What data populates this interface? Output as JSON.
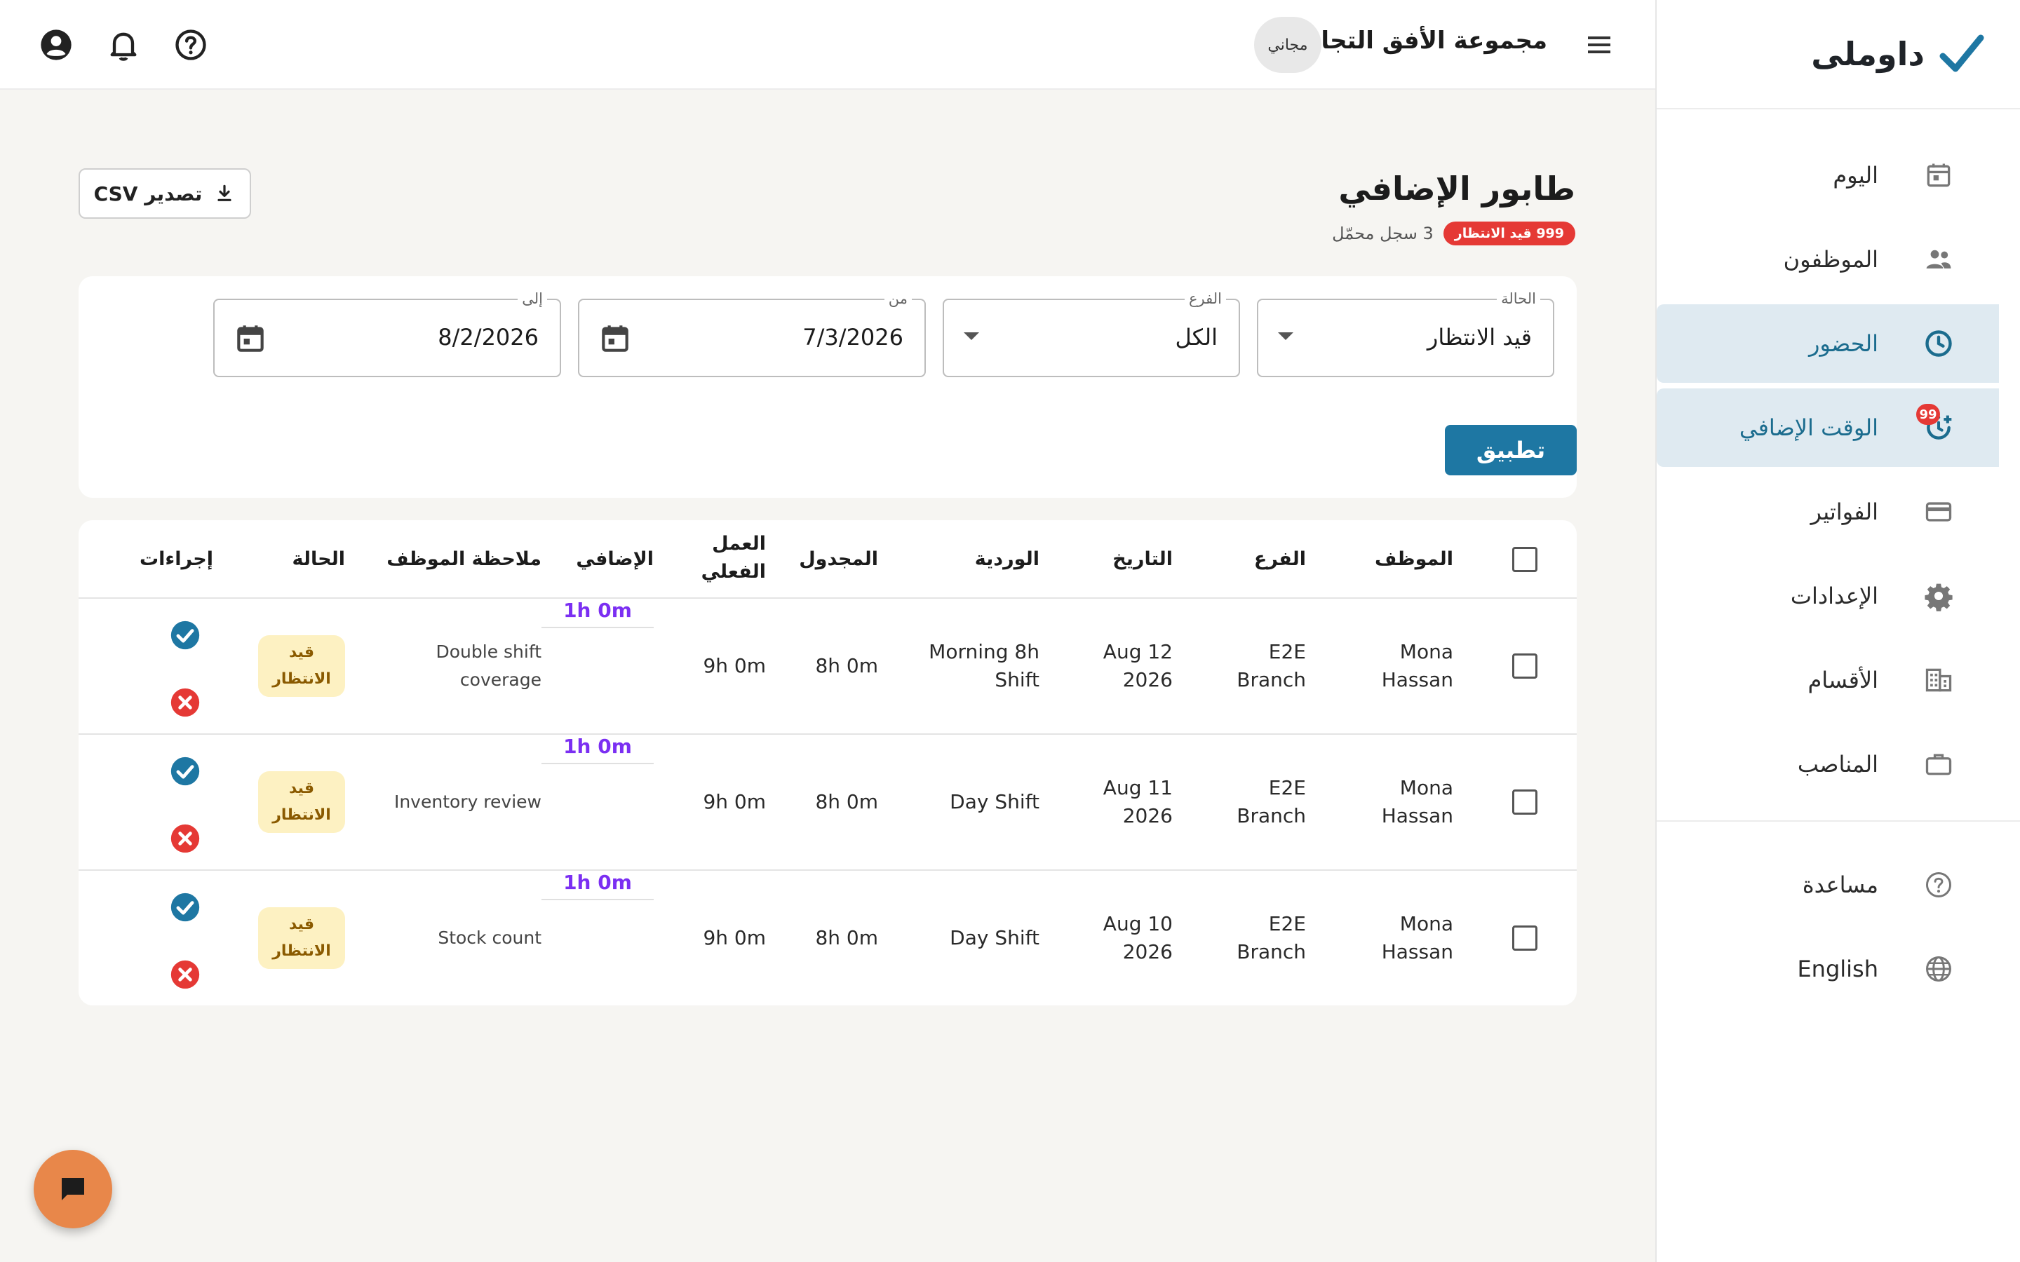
{
  "brand": {
    "name": "داوملى"
  },
  "topbar": {
    "org_name": "مجموعة الأفق التجارية",
    "plan": "مجاني"
  },
  "sidebar": {
    "items": [
      {
        "label": "اليوم",
        "icon": "calendar-icon"
      },
      {
        "label": "الموظفون",
        "icon": "people-icon"
      },
      {
        "label": "الحضور",
        "icon": "clock-icon",
        "active": true
      },
      {
        "label": "الوقت الإضافي",
        "icon": "overtime-clock-icon",
        "badge": "99"
      },
      {
        "label": "الفواتير",
        "icon": "credit-card-icon"
      },
      {
        "label": "الإعدادات",
        "icon": "gear-icon"
      },
      {
        "label": "الأقسام",
        "icon": "building-icon"
      },
      {
        "label": "المناصب",
        "icon": "briefcase-icon"
      }
    ],
    "footer": [
      {
        "label": "مساعدة",
        "icon": "help-icon"
      },
      {
        "label": "English",
        "icon": "globe-icon"
      }
    ]
  },
  "page": {
    "title": "طابور الإضافي",
    "record_count": "3 سجل محمّل",
    "pending_badge": "999 قيد الانتظار",
    "export_label": "تصدير CSV"
  },
  "filters": {
    "status": {
      "label": "الحالة",
      "value": "قيد الانتظار"
    },
    "branch": {
      "label": "الفرع",
      "value": "الكل"
    },
    "from": {
      "label": "من",
      "value": "7/3/2026"
    },
    "to": {
      "label": "إلى",
      "value": "8/2/2026"
    },
    "apply_label": "تطبيق"
  },
  "table": {
    "headers": {
      "employee": "الموظف",
      "branch": "الفرع",
      "date": "التاريخ",
      "shift": "الوردية",
      "scheduled": "المجدول",
      "actual_1": "العمل",
      "actual_2": "الفعلي",
      "overtime": "الإضافي",
      "note": "ملاحظة الموظف",
      "status": "الحالة",
      "actions": "إجراءات"
    },
    "rows": [
      {
        "employee_1": "Mona",
        "employee_2": "Hassan",
        "branch_1": "E2E",
        "branch_2": "Branch",
        "date_1": "Aug 12",
        "date_2": "2026",
        "shift_1": "Morning 8h",
        "shift_2": "Shift",
        "scheduled": "8h 0m",
        "actual": "9h 0m",
        "overtime": "1h 0m",
        "note_1": "Double shift",
        "note_2": "coverage",
        "status_1": "قيد",
        "status_2": "الانتظار"
      },
      {
        "employee_1": "Mona",
        "employee_2": "Hassan",
        "branch_1": "E2E",
        "branch_2": "Branch",
        "date_1": "Aug 11",
        "date_2": "2026",
        "shift_1": "Day Shift",
        "shift_2": "",
        "scheduled": "8h 0m",
        "actual": "9h 0m",
        "overtime": "1h 0m",
        "note_1": "Inventory review",
        "note_2": "",
        "status_1": "قيد",
        "status_2": "الانتظار"
      },
      {
        "employee_1": "Mona",
        "employee_2": "Hassan",
        "branch_1": "E2E",
        "branch_2": "Branch",
        "date_1": "Aug 10",
        "date_2": "2026",
        "shift_1": "Day Shift",
        "shift_2": "",
        "scheduled": "8h 0m",
        "actual": "9h 0m",
        "overtime": "1h 0m",
        "note_1": "Stock count",
        "note_2": "",
        "status_1": "قيد",
        "status_2": "الانتظار"
      }
    ]
  },
  "colors": {
    "accent": "#1e77a3",
    "active_bg": "#dfeaf1",
    "overtime": "#7b2ff2",
    "danger": "#e53935",
    "pending_bg": "#fdf1c2",
    "fab": "#e8874a"
  }
}
